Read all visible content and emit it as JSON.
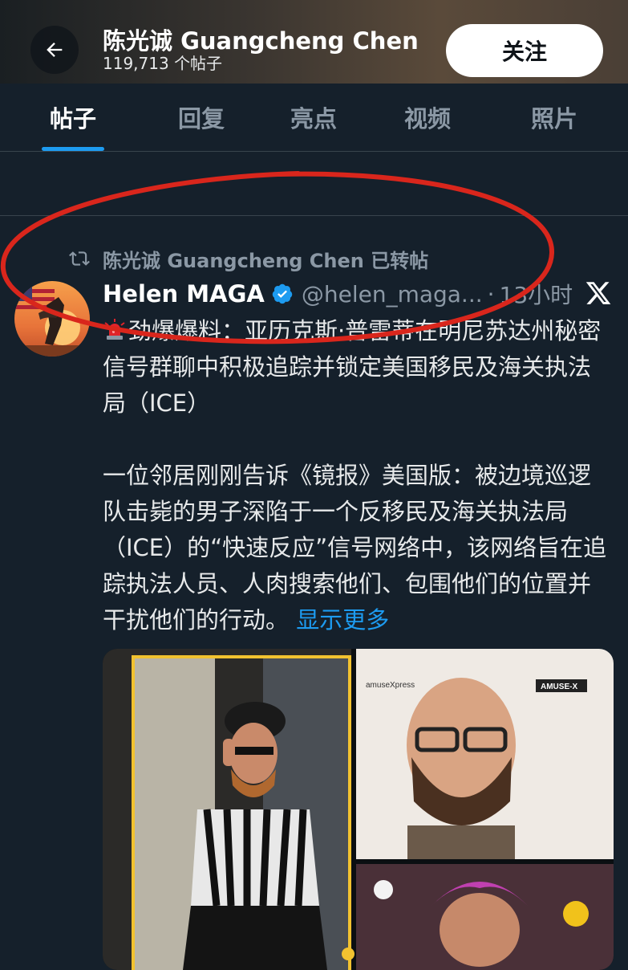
{
  "header": {
    "title": "陈光诚 Guangcheng Chen",
    "post_count": "119,713 个帖子",
    "follow_label": "关注",
    "back_icon": "arrow-left-icon"
  },
  "tabs": [
    {
      "label": "帖子",
      "active": true
    },
    {
      "label": "回复",
      "active": false
    },
    {
      "label": "亮点",
      "active": false
    },
    {
      "label": "视频",
      "active": false
    },
    {
      "label": "照片",
      "active": false
    }
  ],
  "repost": {
    "icon": "repost-icon",
    "text": "陈光诚 Guangcheng Chen 已转帖"
  },
  "tweet": {
    "author": "Helen MAGA",
    "handle": "@helen_maga...",
    "separator": "·",
    "time": "13小时",
    "verified_icon": "verified-badge-icon",
    "platform_icon": "x-logo-icon",
    "paragraph1": "劲爆爆料：亚历克斯·普雷蒂在明尼苏达州秘密信号群聊中积极追踪并锁定美国移民及海关执法局（ICE）",
    "paragraph2": "一位邻居刚刚告诉《镜报》美国版：被边境巡逻队击毙的男子深陷于一个反移民及海关执法局（ICE）的“快速反应”信号网络中，该网络旨在追踪执法人员、人肉搜索他们、包围他们的位置并干扰他们的行动。",
    "show_more": "显示更多",
    "media_labels": {
      "watermark_left": "amuseXpress",
      "watermark_right": "AMUSE-X"
    }
  },
  "colors": {
    "background": "#15202b",
    "accent": "#1d9bf0",
    "annotation": "#d9261c"
  }
}
